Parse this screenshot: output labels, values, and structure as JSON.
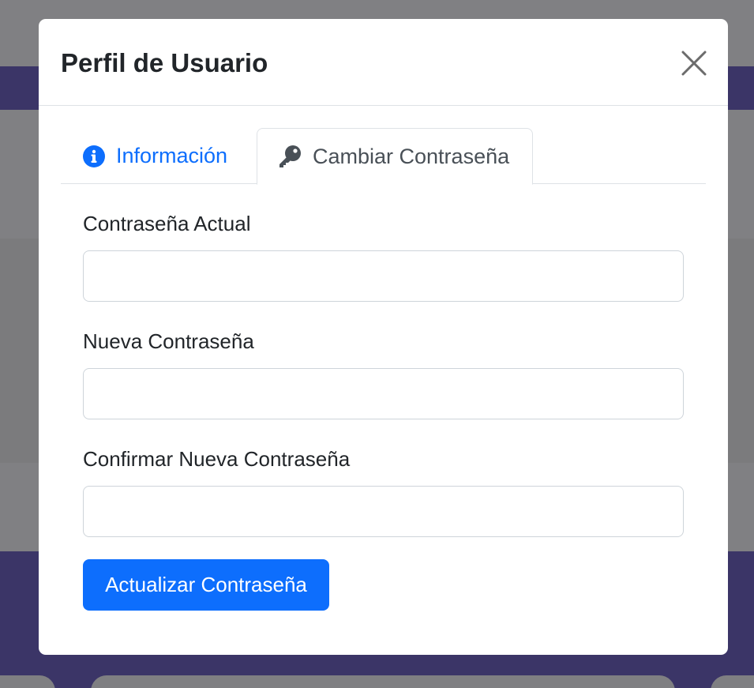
{
  "modal": {
    "title": "Perfil de Usuario"
  },
  "tabs": [
    {
      "label": "Información",
      "icon": "info-circle-icon",
      "active": false
    },
    {
      "label": "Cambiar Contraseña",
      "icon": "key-icon",
      "active": true
    }
  ],
  "form": {
    "current_password": {
      "label": "Contraseña Actual",
      "value": ""
    },
    "new_password": {
      "label": "Nueva Contraseña",
      "value": ""
    },
    "confirm_password": {
      "label": "Confirmar Nueva Contraseña",
      "value": ""
    },
    "submit_label": "Actualizar Contraseña"
  },
  "colors": {
    "primary": "#0d6efd",
    "overlay": "#7f7f81",
    "navbar": "#3b3567",
    "tab_inactive_text": "#495057"
  }
}
